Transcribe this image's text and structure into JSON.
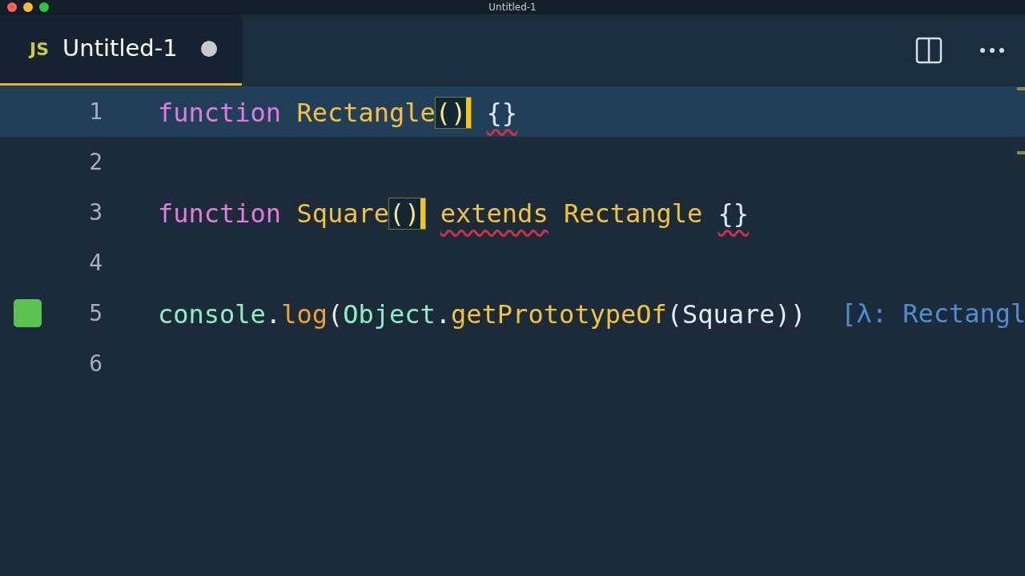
{
  "window": {
    "title": "Untitled-1"
  },
  "tabs": [
    {
      "icon_text": "JS",
      "label": "Untitled-1",
      "selected": true,
      "modified": true
    }
  ],
  "editor": {
    "lines": [
      {
        "number": "1",
        "current": true,
        "marker": false,
        "tokens": [
          {
            "text": "function ",
            "kind": "keyword"
          },
          {
            "text": "Rectangle",
            "kind": "function"
          },
          {
            "text": "()",
            "kind": "paren",
            "matched": true
          },
          {
            "text": " {}",
            "kind": "brace",
            "error": true
          }
        ]
      },
      {
        "number": "2",
        "current": false,
        "marker": false
      },
      {
        "number": "3",
        "current": false,
        "marker": false,
        "tokens": [
          {
            "text": "function ",
            "kind": "keyword"
          },
          {
            "text": "Square",
            "kind": "function"
          },
          {
            "text": "()",
            "kind": "paren",
            "matched": true
          },
          {
            "text": " extends",
            "kind": "function",
            "error": true
          },
          {
            "text": " Rectangle",
            "kind": "function"
          },
          {
            "text": " {}",
            "kind": "brace",
            "error": true
          }
        ]
      },
      {
        "number": "4",
        "current": false,
        "marker": false
      },
      {
        "number": "5",
        "current": false,
        "marker": true,
        "tokens": [
          {
            "text": "console",
            "kind": "object"
          },
          {
            "text": ".",
            "kind": "punct"
          },
          {
            "text": "log",
            "kind": "method"
          },
          {
            "text": "(",
            "kind": "punct"
          },
          {
            "text": "Object",
            "kind": "object"
          },
          {
            "text": ".",
            "kind": "punct"
          },
          {
            "text": "getPrototypeOf",
            "kind": "function"
          },
          {
            "text": "(",
            "kind": "punct"
          },
          {
            "text": "Square",
            "kind": "punct"
          },
          {
            "text": "))",
            "kind": "punct"
          }
        ],
        "inline_result": "[λ: Rectangl"
      },
      {
        "number": "6",
        "current": false,
        "marker": false
      }
    ]
  }
}
